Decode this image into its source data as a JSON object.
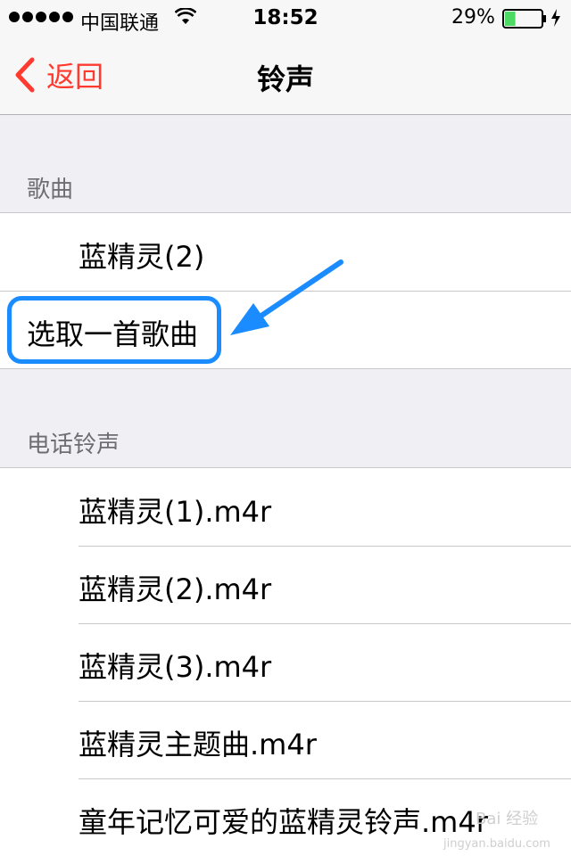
{
  "status_bar": {
    "carrier": "中国联通",
    "time": "18:52",
    "battery_percent": "29%",
    "battery_level": 0.29
  },
  "nav": {
    "back_label": "返回",
    "title": "铃声"
  },
  "songs_section": {
    "header": "歌曲",
    "items": [
      {
        "label": "蓝精灵(2)"
      },
      {
        "label": "选取一首歌曲"
      }
    ]
  },
  "ringtones_section": {
    "header": "电话铃声",
    "items": [
      {
        "label": "蓝精灵(1).m4r"
      },
      {
        "label": "蓝精灵(2).m4r"
      },
      {
        "label": "蓝精灵(3).m4r"
      },
      {
        "label": "蓝精灵主题曲.m4r"
      },
      {
        "label": "童年记忆可爱的蓝精灵铃声.m4r"
      }
    ]
  },
  "watermark": {
    "text": "Bai 经验",
    "subtext": "jingyan.baidu.com"
  },
  "colors": {
    "accent": "#ff3b30",
    "highlight": "#1a8cff",
    "battery": "#4cd964"
  }
}
